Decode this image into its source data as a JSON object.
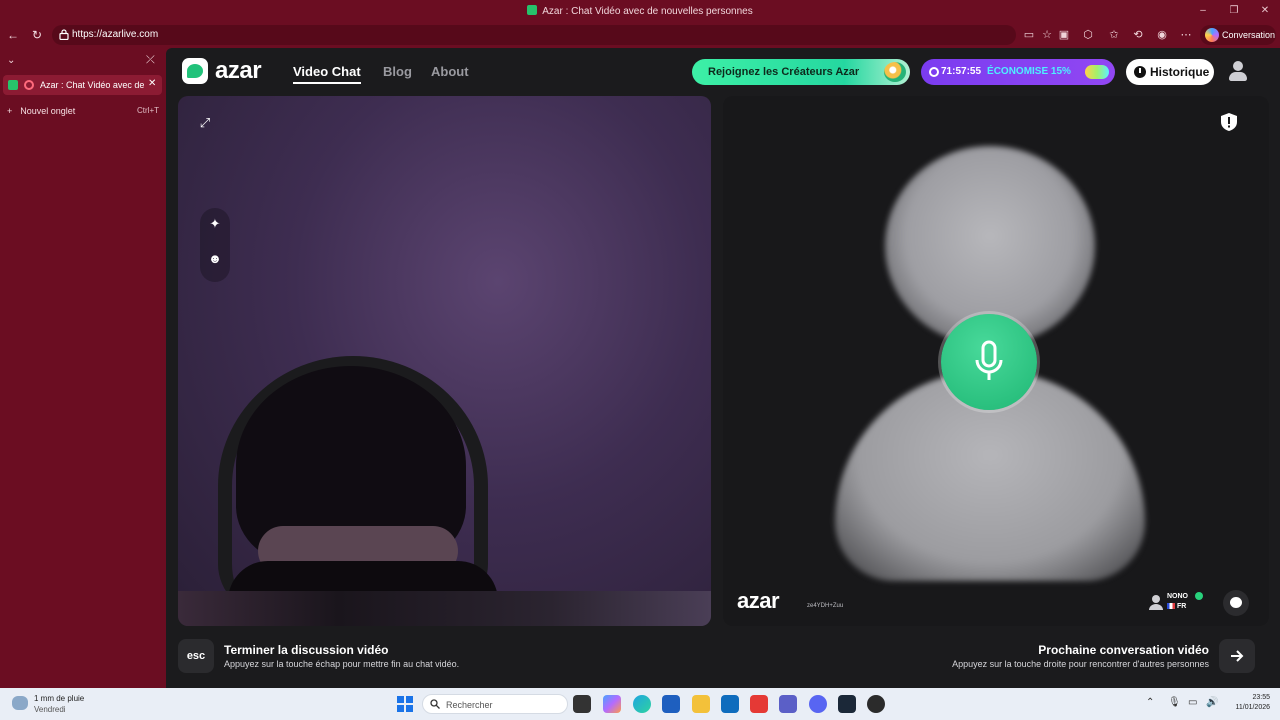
{
  "window": {
    "title": "Azar : Chat Vidéo avec de nouvelles personnes"
  },
  "browser": {
    "url": "https://azarlive.com",
    "conversation_label": "Conversation",
    "tabs": [
      {
        "label": "Azar : Chat Vidéo avec de nouvelles personnes"
      }
    ],
    "new_tab": {
      "label": "Nouvel onglet",
      "shortcut": "Ctrl+T"
    }
  },
  "site": {
    "brand": "azar",
    "nav": [
      {
        "label": "Video Chat",
        "active": true
      },
      {
        "label": "Blog",
        "active": false
      },
      {
        "label": "About",
        "active": false
      }
    ],
    "creators_pill": "Rejoignez les Créateurs Azar",
    "timer": "71:57:55",
    "discount": "ÉCONOMISE 15%",
    "history": "Historique"
  },
  "remote": {
    "watermark": "azar",
    "watermark_id": "ze4YDH+Zuu",
    "peer_name": "NONO",
    "peer_country": "FR"
  },
  "footer": {
    "esc_key": "esc",
    "end_title": "Terminer la discussion vidéo",
    "end_sub": "Appuyez sur la touche échap pour mettre fin au chat vidéo.",
    "next_title": "Prochaine conversation vidéo",
    "next_sub": "Appuyez sur la touche droite pour rencontrer d'autres personnes"
  },
  "taskbar": {
    "weather_line1": "1 mm de pluie",
    "weather_line2": "Vendredi",
    "search_placeholder": "Rechercher",
    "time": "23:55",
    "date": "11/01/2026"
  },
  "colors": {
    "browser_frame": "#6b0d22",
    "page_bg": "#1b1b1d",
    "accent_green": "#21c27a",
    "accent_purple": "#8442f2"
  }
}
